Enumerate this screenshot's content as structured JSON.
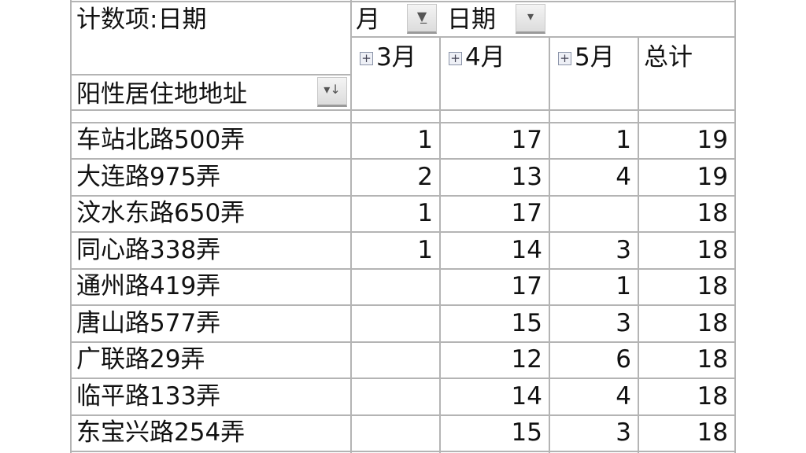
{
  "header": {
    "value_field": "计数项:日期",
    "col_field_1": "月",
    "col_field_2": "日期",
    "row_field": "阳性居住地地址",
    "columns": [
      "3月",
      "4月",
      "5月",
      "总计"
    ]
  },
  "icons": {
    "filter_active": "filter-icon",
    "dropdown": "chevron-down-icon",
    "sort": "sort-descending-icon",
    "expand": "plus-box-icon"
  },
  "rows": [
    {
      "label": "车站北路500弄",
      "m3": "1",
      "m4": "17",
      "m5": "1",
      "total": "19"
    },
    {
      "label": "大连路975弄",
      "m3": "2",
      "m4": "13",
      "m5": "4",
      "total": "19"
    },
    {
      "label": "汶水东路650弄",
      "m3": "1",
      "m4": "17",
      "m5": "",
      "total": "18"
    },
    {
      "label": "同心路338弄",
      "m3": "1",
      "m4": "14",
      "m5": "3",
      "total": "18"
    },
    {
      "label": "通州路419弄",
      "m3": "",
      "m4": "17",
      "m5": "1",
      "total": "18"
    },
    {
      "label": "唐山路577弄",
      "m3": "",
      "m4": "15",
      "m5": "3",
      "total": "18"
    },
    {
      "label": "广联路29弄",
      "m3": "",
      "m4": "12",
      "m5": "6",
      "total": "18"
    },
    {
      "label": "临平路133弄",
      "m3": "",
      "m4": "14",
      "m5": "4",
      "total": "18"
    },
    {
      "label": "东宝兴路254弄",
      "m3": "",
      "m4": "15",
      "m5": "3",
      "total": "18"
    }
  ]
}
